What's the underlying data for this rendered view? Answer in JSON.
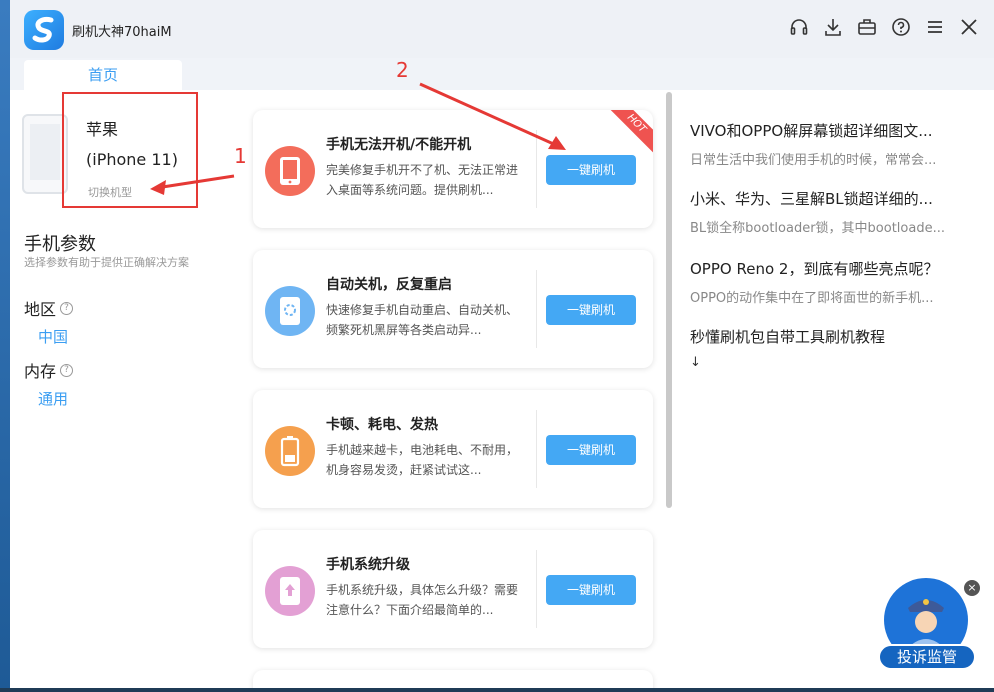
{
  "app": {
    "title": "刷机大神70haiM"
  },
  "tabs": [
    {
      "label": "首页"
    }
  ],
  "device": {
    "brand": "苹果",
    "model": "(iPhone 11)",
    "switch_label": "切换机型"
  },
  "params": {
    "title": "手机参数",
    "subtitle": "选择参数有助于提供正确解决方案",
    "region_label": "地区",
    "region_value": "中国",
    "memory_label": "内存",
    "memory_value": "通用",
    "help_glyph": "?"
  },
  "cards": [
    {
      "title": "手机无法开机/不能开机",
      "desc": "完美修复手机开不了机、无法正常进入桌面等系统问题。提供刷机...",
      "button": "一键刷机",
      "badge": "HOT",
      "icon": "phone-icon",
      "color": "#f36d5b"
    },
    {
      "title": "自动关机，反复重启",
      "desc": "快速修复手机自动重启、自动关机、频繁死机黑屏等各类启动异...",
      "button": "一键刷机",
      "icon": "restart-icon",
      "color": "#6fb5f3"
    },
    {
      "title": "卡顿、耗电、发热",
      "desc": "手机越来越卡，电池耗电、不耐用，机身容易发烫，赶紧试试这...",
      "button": "一键刷机",
      "icon": "battery-icon",
      "color": "#f5a04e"
    },
    {
      "title": "手机系统升级",
      "desc": "手机系统升级，具体怎么升级？需要注意什么？下面介绍最简单的...",
      "button": "一键刷机",
      "icon": "upgrade-icon",
      "color": "#e3a0d4"
    }
  ],
  "articles": [
    {
      "title": "VIVO和OPPO解屏幕锁超详细图文...",
      "summary": "日常生活中我们使用手机的时候，常常会..."
    },
    {
      "title": "小米、华为、三星解BL锁超详细的...",
      "summary": "BL锁全称bootloader锁，其中bootloade..."
    },
    {
      "title": "OPPO Reno 2，到底有哪些亮点呢？",
      "summary": "OPPO的动作集中在了即将面世的新手机..."
    },
    {
      "title": "秒懂刷机包自带工具刷机教程",
      "summary": "↓"
    }
  ],
  "annotations": {
    "label1": "1",
    "label2": "2",
    "color": "#e53935"
  },
  "complaint": {
    "label": "投诉监管",
    "close": "×"
  },
  "title_icons": [
    "headset-icon",
    "download-icon",
    "toolbox-icon",
    "help-icon",
    "menu-icon",
    "close-icon"
  ]
}
